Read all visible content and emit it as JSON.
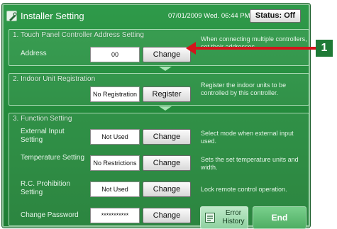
{
  "window": {
    "title": "Installer Setting",
    "datetime": "07/01/2009 Wed. 06:44 PM",
    "status_button": "Status: Off",
    "icon": "settings-icon"
  },
  "section1": {
    "title": "1. Touch Panel Controller Address Setting",
    "address_label": "Address",
    "address_value": "00",
    "change_label": "Change",
    "hint": "When connecting multiple controllers, set their addresses."
  },
  "section2": {
    "title": "2. Indoor Unit Registration",
    "value": "No Registration",
    "register_label": "Register",
    "hint": "Register the indoor units to be controlled by this controller."
  },
  "section3": {
    "title": "3. Function Setting",
    "rows": [
      {
        "label": "External Input Setting",
        "value": "Not Used",
        "button": "Change",
        "hint": "Select mode when external input used."
      },
      {
        "label": "Temperature Setting",
        "value": "No Restrictions",
        "button": "Change",
        "hint": "Sets the set temperature units and width."
      },
      {
        "label": "R.C. Prohibition Setting",
        "value": "Not Used",
        "button": "Change",
        "hint": "Lock remote control operation."
      },
      {
        "label": "Change Password",
        "value": "***********",
        "button": "Change",
        "hint": ""
      }
    ]
  },
  "footer": {
    "error_history": "Error History",
    "end": "End",
    "error_icon": "error-history-icon"
  },
  "callout": {
    "number": "1",
    "color": "#d4141b"
  },
  "colors": {
    "screen_green": "#248a3c",
    "accent_light": "#a6e2b3"
  }
}
